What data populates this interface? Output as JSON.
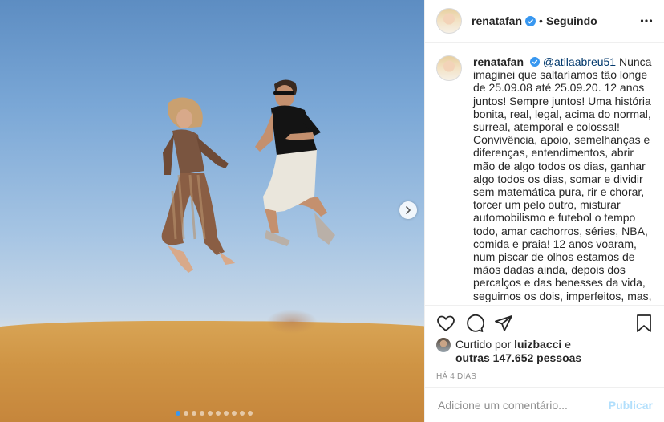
{
  "post": {
    "username": "renatafan",
    "follow_status": "Seguindo",
    "separator": "•",
    "verified_color": "#3897f0"
  },
  "caption": {
    "username": "renatafan",
    "mention": "@atilaabreu51",
    "text": " Nunca imaginei que saltaríamos tão longe de 25.09.08 até 25.09.20. 12 anos juntos! Sempre juntos! Uma história bonita, real, legal, acima do normal, surreal, atemporal e colossal! Convivência, apoio, semelhanças e diferenças, entendimentos, abrir mão de algo todos os dias, ganhar algo todos os dias, somar e dividir sem matemática pura, rir e chorar, torcer um pelo outro, misturar automobilismo e futebol o tempo todo, amar cachorros, séries, NBA, comida e praia! 12 anos voaram, num piscar de olhos estamos de mãos dadas ainda, depois dos percalços e das benesses da vida, seguimos os dois, imperfeitos, mas, perfeitos no"
  },
  "likes": {
    "prefix": "Curtido por",
    "user": "luizbacci",
    "conj": "e",
    "others": "outras 147.652 pessoas"
  },
  "timestamp": "HÁ 4 DIAS",
  "comment": {
    "placeholder": "Adicione um comentário...",
    "publish_label": "Publicar"
  },
  "carousel": {
    "count": 10,
    "active_index": 0
  },
  "icons": {
    "verified": "verified-badge-icon",
    "more": "more-options-icon",
    "like": "heart-icon",
    "comment": "comment-bubble-icon",
    "share": "paper-plane-icon",
    "save": "bookmark-icon",
    "next": "chevron-right-icon"
  }
}
